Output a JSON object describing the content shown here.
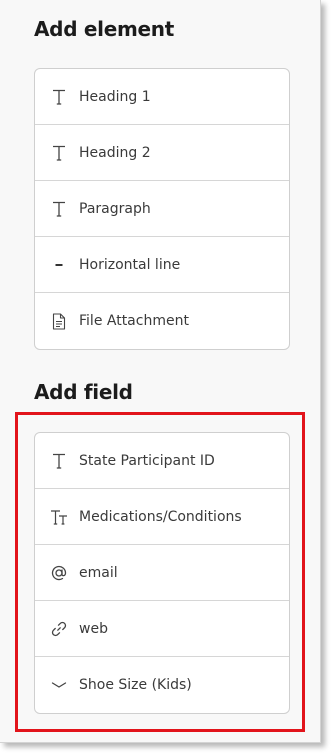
{
  "add_element": {
    "title": "Add element",
    "items": [
      {
        "label": "Heading 1",
        "icon": "text-type-icon"
      },
      {
        "label": "Heading 2",
        "icon": "text-type-icon"
      },
      {
        "label": "Paragraph",
        "icon": "text-type-icon"
      },
      {
        "label": "Horizontal line",
        "icon": "horizontal-line-icon"
      },
      {
        "label": "File Attachment",
        "icon": "file-icon"
      }
    ]
  },
  "add_field": {
    "title": "Add field",
    "items": [
      {
        "label": "State Participant ID",
        "icon": "text-type-icon"
      },
      {
        "label": "Medications/Conditions",
        "icon": "text-size-icon"
      },
      {
        "label": "email",
        "icon": "at-sign-icon"
      },
      {
        "label": "web",
        "icon": "link-icon"
      },
      {
        "label": "Shoe Size (Kids)",
        "icon": "chevron-down-icon"
      }
    ]
  },
  "colors": {
    "highlight": "#e2141b",
    "heading": "#1c1c1c",
    "label": "#3a3a3a"
  }
}
